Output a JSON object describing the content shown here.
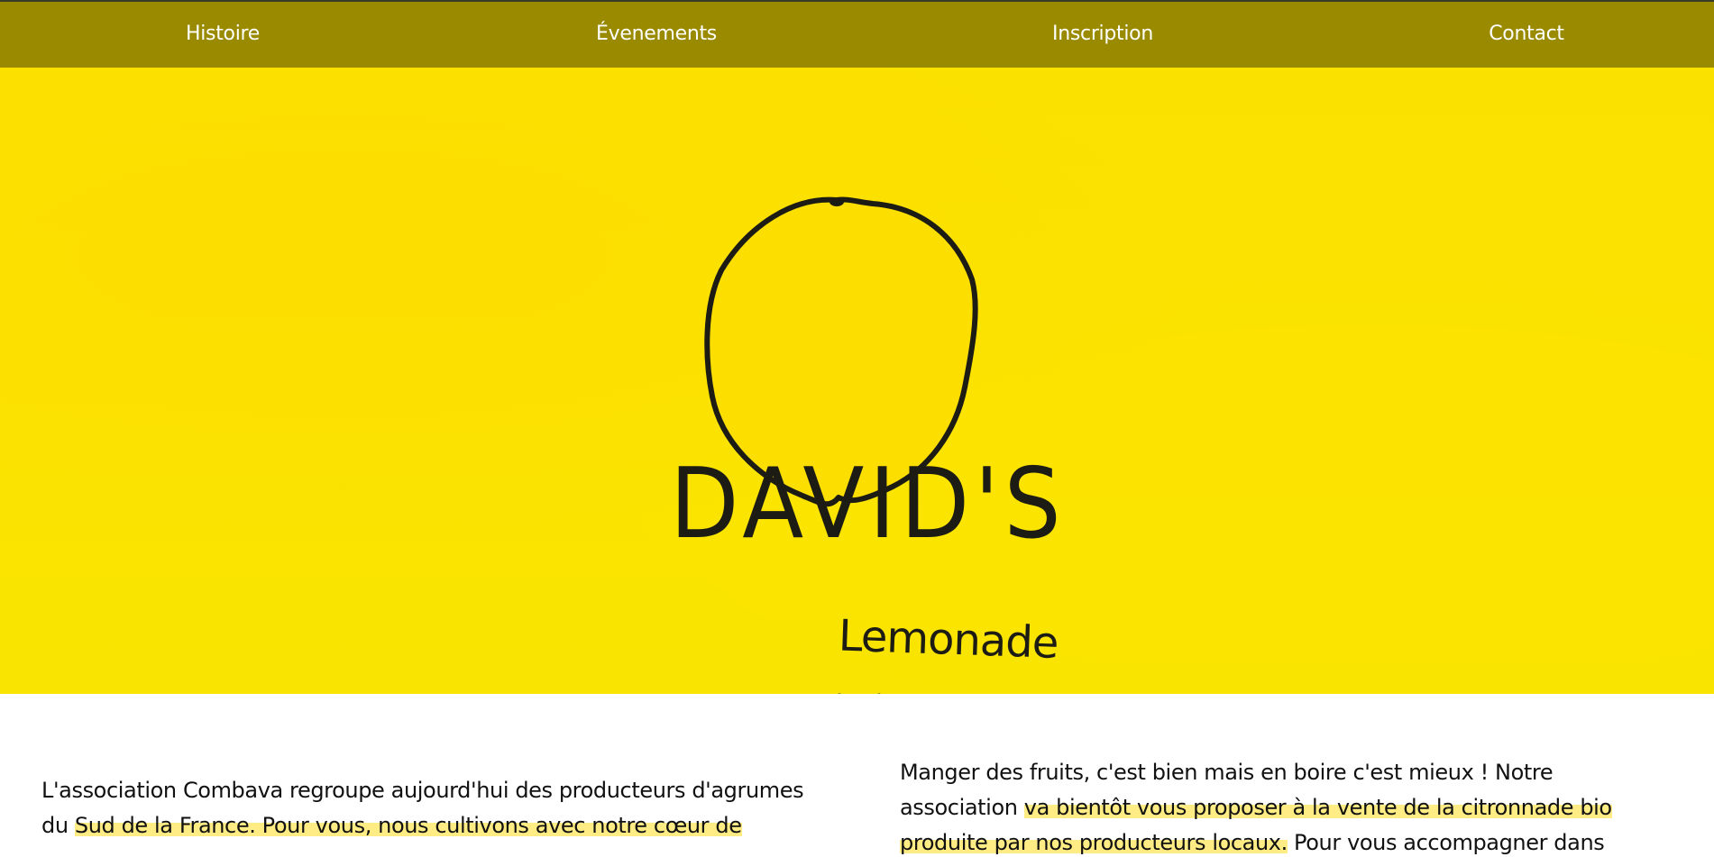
{
  "nav": {
    "items": [
      {
        "label": "Histoire"
      },
      {
        "label": "Évenements"
      },
      {
        "label": "Inscription"
      },
      {
        "label": "Contact"
      }
    ]
  },
  "hero": {
    "logo_title": "DAVID'S",
    "logo_subtitle": "Lemonade",
    "scroll_icon": "chevron-down-icon"
  },
  "content": {
    "left": {
      "text_start": "L'association Combava regroupe aujourd'hui des producteurs d'agrumes du ",
      "text_highlight": "Sud de la France. Pour vous, nous cultivons avec notre cœur de",
      "text_end": " "
    },
    "right": {
      "text_start": "Manger des fruits, c'est bien mais en boire c'est mieux ! Notre association ",
      "text_highlight": "va bientôt vous proposer à la vente de la citronnade bio produite par nos producteurs locaux.",
      "text_end": " Pour vous accompagner dans"
    }
  },
  "colors": {
    "nav_bg": "#998a00",
    "hero_bg": "#fbe100",
    "ink": "#1c1c14",
    "highlight": "#ffe65a"
  }
}
